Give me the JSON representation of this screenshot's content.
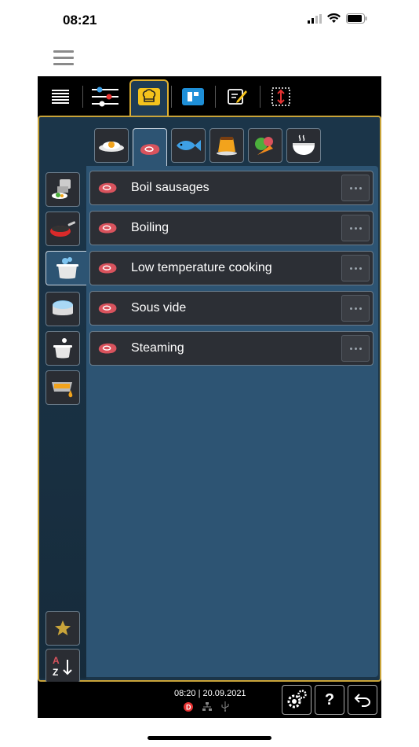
{
  "status": {
    "time": "08:21"
  },
  "topbar": {
    "tabs": [
      {
        "icon": "list-lines-icon"
      },
      {
        "icon": "sliders-icon"
      },
      {
        "icon": "chef-hat-icon",
        "active": true
      },
      {
        "icon": "program-blocks-icon"
      },
      {
        "icon": "edit-note-icon"
      },
      {
        "icon": "height-adjust-icon"
      }
    ]
  },
  "categories": [
    {
      "icon": "egg-icon"
    },
    {
      "icon": "meat-icon",
      "active": true
    },
    {
      "icon": "fish-icon"
    },
    {
      "icon": "dessert-icon"
    },
    {
      "icon": "vegetables-icon"
    },
    {
      "icon": "soup-icon"
    }
  ],
  "methods": [
    {
      "icon": "steamer-pot-icon"
    },
    {
      "icon": "frying-pan-icon"
    },
    {
      "icon": "boiling-pot-icon",
      "active": true
    },
    {
      "icon": "sous-vide-icon"
    },
    {
      "icon": "steam-icon"
    },
    {
      "icon": "baking-tray-icon"
    }
  ],
  "list": {
    "items": [
      {
        "label": "Boil sausages"
      },
      {
        "label": "Boiling"
      },
      {
        "label": "Low temperature cooking"
      },
      {
        "label": "Sous vide"
      },
      {
        "label": "Steaming"
      }
    ]
  },
  "footer": {
    "datetime": "08:20 | 20.09.2021",
    "help_label": "?"
  },
  "colors": {
    "accent": "#c9a43a",
    "panel": "#2d5473",
    "item": "#2c2f35",
    "meat": "#d9535d"
  }
}
